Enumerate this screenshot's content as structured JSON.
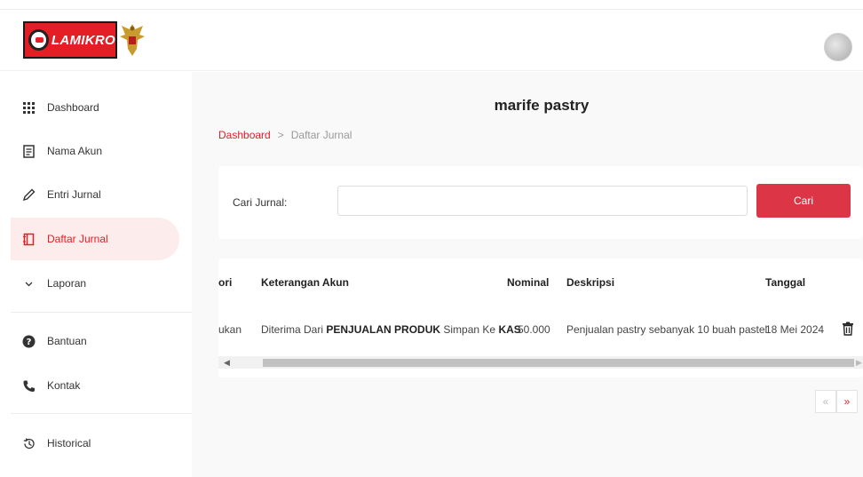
{
  "header": {
    "brand": "LAMIKRO",
    "avatar_icon": "user-avatar-icon"
  },
  "sidebar": {
    "items": [
      {
        "label": "Dashboard",
        "icon": "grid-icon"
      },
      {
        "label": "Nama Akun",
        "icon": "document-icon"
      },
      {
        "label": "Entri Jurnal",
        "icon": "pencil-icon"
      },
      {
        "label": "Daftar Jurnal",
        "icon": "notebook-icon",
        "active": true
      },
      {
        "label": "Laporan",
        "icon": "chevron-down-icon"
      },
      {
        "label": "Bantuan",
        "icon": "question-icon"
      },
      {
        "label": "Kontak",
        "icon": "phone-icon"
      },
      {
        "label": "Historical",
        "icon": "history-icon"
      }
    ]
  },
  "main": {
    "title": "marife pastry",
    "breadcrumb": {
      "link": "Dashboard",
      "separator": ">",
      "current": "Daftar Jurnal"
    },
    "search": {
      "label": "Cari Jurnal:",
      "value": "",
      "placeholder": "",
      "button": "Cari"
    },
    "table": {
      "headers": [
        "ori",
        "Keterangan Akun",
        "Nominal",
        "Deskripsi",
        "Tanggal"
      ],
      "rows": [
        {
          "kategori": "ukan",
          "keterangan_prefix": "Diterima Dari",
          "keterangan_from": "PENJUALAN PRODUK",
          "keterangan_mid": "Simpan Ke",
          "keterangan_to": "KAS",
          "nominal": "50.000",
          "deskripsi": "Penjualan pastry sebanyak 10 buah pastel",
          "tanggal": "18 Mei 2024",
          "action_icon": "trash-icon"
        }
      ]
    },
    "pagination": {
      "prev": "«",
      "next": "»"
    }
  },
  "colors": {
    "accent": "#e31e24",
    "button": "#dc3545",
    "active_bg": "#fdecec"
  }
}
